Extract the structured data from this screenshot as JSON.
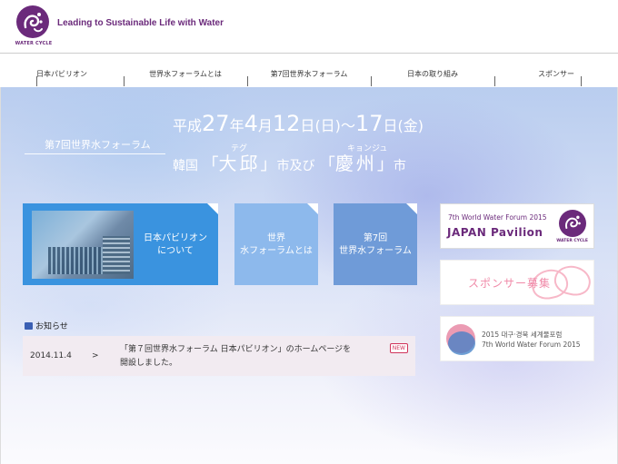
{
  "header": {
    "logo_text": "WATER CYCLE",
    "tagline": "Leading to Sustainable Life with Water"
  },
  "nav": [
    {
      "label": "日本パビリオン"
    },
    {
      "label": "世界水フォーラムとは"
    },
    {
      "label": "第7回世界水フォーラム"
    },
    {
      "label": "日本の取り組み"
    },
    {
      "label": "スポンサー"
    }
  ],
  "hero": {
    "subtitle": "第7回世界水フォーラム",
    "date_prefix": "平成",
    "year": "27",
    "year_unit": "年",
    "month": "4",
    "month_unit": "月",
    "day_start": "12",
    "day_unit": "日",
    "weekday_start": "(日)",
    "tilde": "～",
    "day_end": "17",
    "weekday_end": "(金)",
    "country": "韓国",
    "city1": "大邱",
    "city1_ruby": "テグ",
    "and": "市及び",
    "city2": "慶州",
    "city2_ruby": "キョンジュ",
    "city_suffix": "市"
  },
  "tiles": {
    "japan_pavilion": "日本パビリオン\nについて",
    "world_water_forum": "世界\n水フォーラムとは",
    "seventh_forum": "第7回\n世界水フォーラム"
  },
  "banners": {
    "pavilion_sup": "7th World Water Forum 2015",
    "pavilion_main": "JAPAN Pavilion",
    "pavilion_logo_text": "WATER CYCLE",
    "sponsor": "スポンサー募集",
    "forum_line1": "2015 대구·경북 세계물포럼",
    "forum_line2": "7th World Water Forum 2015"
  },
  "news": {
    "heading": "お知らせ",
    "items": [
      {
        "date": "2014.11.4",
        "arrow": ">",
        "text": "「第７回世界水フォーラム 日本パビリオン」のホームページを\n開設しました。",
        "badge": "NEW"
      }
    ]
  },
  "colors": {
    "brand_purple": "#6b2a7b",
    "tile_blue": "#3a93df",
    "tile_light_blue": "#8db9ec",
    "tile_mid_blue": "#6f9bd8",
    "sponsor_pink": "#f08aa8"
  }
}
